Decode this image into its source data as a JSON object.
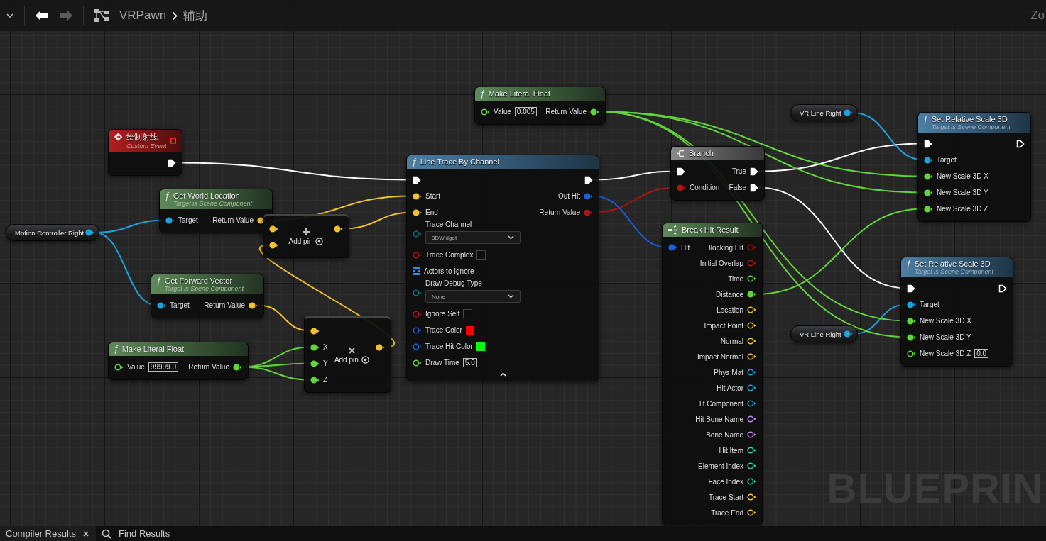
{
  "toolbar": {
    "back_disabled": false,
    "forward_disabled": true,
    "breadcrumb": [
      "VRPawn",
      "辅助"
    ],
    "zoom_label": "Zo"
  },
  "graph": {
    "watermark": "BLUEPRIN",
    "nodes": [
      {
        "kind": "event",
        "title": "绘制射线",
        "subtitle": "Custom Event",
        "rows": [
          {
            "right": {
              "kind": "exec",
              "connected": true
            }
          }
        ]
      },
      {
        "kind": "pure",
        "icon": "ƒ",
        "title": "Get World Location",
        "subtitle": "Target is Scene Component",
        "rows": [
          {
            "left": {
              "label": "Target",
              "kind": "object",
              "connected": true
            },
            "right": {
              "label": "Return Value",
              "kind": "vector",
              "connected": true
            }
          }
        ]
      },
      {
        "kind": "variable",
        "title": "Motion Controller Right",
        "rows": [
          {
            "right": {
              "kind": "object",
              "connected": true
            }
          }
        ]
      },
      {
        "kind": "add",
        "add_pin": "Add pin",
        "rows": [
          {
            "left": {
              "kind": "vector",
              "connected": true
            },
            "right": {
              "kind": "vector",
              "connected": true
            }
          },
          {
            "left": {
              "kind": "vector",
              "connected": true
            }
          }
        ]
      },
      {
        "kind": "pure",
        "icon": "ƒ",
        "title": "Get Forward Vector",
        "subtitle": "Target is Scene Component",
        "rows": [
          {
            "left": {
              "label": "Target",
              "kind": "object",
              "connected": true
            },
            "right": {
              "label": "Return Value",
              "kind": "vector",
              "connected": true
            }
          }
        ]
      },
      {
        "kind": "pure",
        "icon": "ƒ",
        "title": "Make Literal Float",
        "rows": [
          {
            "left": {
              "label": "Value",
              "kind": "float",
              "connected": false,
              "widget": {
                "kind": "text",
                "value": "99999.0"
              }
            },
            "right": {
              "label": "Return Value",
              "kind": "float",
              "connected": true
            }
          }
        ]
      },
      {
        "kind": "multiply",
        "add_pin": "Add pin",
        "rows": [
          {
            "left": {
              "kind": "vector",
              "connected": true
            }
          },
          {
            "left": {
              "label": "X",
              "kind": "float",
              "connected": true
            },
            "right": {
              "kind": "vector",
              "connected": true
            }
          },
          {
            "left": {
              "label": "Y",
              "kind": "float",
              "connected": true
            }
          },
          {
            "left": {
              "label": "Z",
              "kind": "float",
              "connected": true
            }
          }
        ]
      },
      {
        "kind": "pure",
        "icon": "ƒ",
        "title": "Make Literal Float",
        "rows": [
          {
            "left": {
              "label": "Value",
              "kind": "float",
              "connected": false,
              "widget": {
                "kind": "text",
                "value": "0.005"
              }
            },
            "right": {
              "label": "Return Value",
              "kind": "float",
              "connected": true
            }
          }
        ]
      },
      {
        "kind": "function",
        "icon": "ƒ",
        "title": "Line Trace By Channel",
        "advanced_expanded": true,
        "rows": [
          {
            "left": {
              "kind": "exec",
              "connected": true
            },
            "right": {
              "kind": "exec",
              "connected": true
            }
          },
          {
            "left": {
              "label": "Start",
              "kind": "vector",
              "connected": true
            },
            "right": {
              "label": "Out Hit",
              "kind": "struct",
              "connected": true
            }
          },
          {
            "left": {
              "label": "End",
              "kind": "vector",
              "connected": true
            },
            "right": {
              "label": "Return Value",
              "kind": "bool",
              "connected": true
            }
          },
          {
            "left": {
              "label": "Trace Channel",
              "kind": "enum",
              "connected": false,
              "widget": {
                "kind": "dropdown",
                "value": "3DWidget"
              }
            }
          },
          {
            "left": {
              "label": "Trace Complex",
              "kind": "bool",
              "connected": false,
              "widget": {
                "kind": "checkbox",
                "checked": false
              }
            }
          },
          {
            "left": {
              "label": "Actors to Ignore",
              "kind": "array",
              "connected": false
            }
          },
          {
            "left": {
              "label": "Draw Debug Type",
              "kind": "enum",
              "connected": false,
              "widget": {
                "kind": "dropdown",
                "value": "None"
              }
            }
          },
          {
            "left": {
              "label": "Ignore Self",
              "kind": "bool",
              "connected": false,
              "widget": {
                "kind": "checkbox",
                "checked": false
              }
            }
          },
          {
            "left": {
              "label": "Trace Color",
              "kind": "struct",
              "connected": false,
              "widget": {
                "kind": "swatch",
                "color": "#ff0000"
              }
            }
          },
          {
            "left": {
              "label": "Trace Hit Color",
              "kind": "struct",
              "connected": false,
              "widget": {
                "kind": "swatch",
                "color": "#00ff00"
              }
            }
          },
          {
            "left": {
              "label": "Draw Time",
              "kind": "float",
              "connected": false,
              "widget": {
                "kind": "text",
                "value": "5.0"
              }
            }
          }
        ]
      },
      {
        "kind": "branch",
        "title": "Branch",
        "rows": [
          {
            "left": {
              "kind": "exec",
              "connected": true
            },
            "right": {
              "label": "True",
              "kind": "exec",
              "connected": true
            }
          },
          {
            "left": {
              "label": "Condition",
              "kind": "bool",
              "connected": true
            },
            "right": {
              "label": "False",
              "kind": "exec",
              "connected": true
            }
          }
        ]
      },
      {
        "kind": "break",
        "title": "Break Hit Result",
        "rows": [
          {
            "left": {
              "label": "Hit",
              "kind": "struct",
              "connected": true
            },
            "right": {
              "label": "Blocking Hit",
              "kind": "bool",
              "connected": false
            }
          },
          {
            "right": {
              "label": "Initial Overlap",
              "kind": "bool",
              "connected": false
            }
          },
          {
            "right": {
              "label": "Time",
              "kind": "float",
              "connected": false
            }
          },
          {
            "right": {
              "label": "Distance",
              "kind": "float",
              "connected": true
            }
          },
          {
            "right": {
              "label": "Location",
              "kind": "vector",
              "connected": false
            }
          },
          {
            "right": {
              "label": "Impact Point",
              "kind": "vector",
              "connected": false
            }
          },
          {
            "right": {
              "label": "Normal",
              "kind": "vector",
              "connected": false
            }
          },
          {
            "right": {
              "label": "Impact Normal",
              "kind": "vector",
              "connected": false
            }
          },
          {
            "right": {
              "label": "Phys Mat",
              "kind": "object",
              "connected": false
            }
          },
          {
            "right": {
              "label": "Hit Actor",
              "kind": "object",
              "connected": false
            }
          },
          {
            "right": {
              "label": "Hit Component",
              "kind": "object",
              "connected": false
            }
          },
          {
            "right": {
              "label": "Hit Bone Name",
              "kind": "name",
              "connected": false
            }
          },
          {
            "right": {
              "label": "Bone Name",
              "kind": "name",
              "connected": false
            }
          },
          {
            "right": {
              "label": "Hit Item",
              "kind": "int",
              "connected": false
            }
          },
          {
            "right": {
              "label": "Element Index",
              "kind": "int",
              "connected": false
            }
          },
          {
            "right": {
              "label": "Face Index",
              "kind": "int",
              "connected": false
            }
          },
          {
            "right": {
              "label": "Trace Start",
              "kind": "vector",
              "connected": false
            }
          },
          {
            "right": {
              "label": "Trace End",
              "kind": "vector",
              "connected": false
            }
          }
        ]
      },
      {
        "kind": "variable",
        "title": "VR Line Right",
        "rows": [
          {
            "right": {
              "kind": "object",
              "connected": true
            }
          }
        ]
      },
      {
        "kind": "function",
        "icon": "ƒ",
        "title": "Set Relative Scale 3D",
        "subtitle": "Target is Scene Component",
        "rows": [
          {
            "left": {
              "kind": "exec",
              "connected": true
            },
            "right": {
              "kind": "exec",
              "connected": false
            }
          },
          {
            "left": {
              "label": "Target",
              "kind": "object",
              "connected": true
            }
          },
          {
            "left": {
              "label": "New Scale 3D X",
              "kind": "float",
              "connected": true
            }
          },
          {
            "left": {
              "label": "New Scale 3D Y",
              "kind": "float",
              "connected": true
            }
          },
          {
            "left": {
              "label": "New Scale 3D Z",
              "kind": "float",
              "connected": true
            }
          }
        ]
      },
      {
        "kind": "variable",
        "title": "VR Line Right",
        "rows": [
          {
            "right": {
              "kind": "object",
              "connected": true
            }
          }
        ]
      },
      {
        "kind": "function",
        "icon": "ƒ",
        "title": "Set Relative Scale 3D",
        "subtitle": "Target is Scene Component",
        "rows": [
          {
            "left": {
              "kind": "exec",
              "connected": true
            },
            "right": {
              "kind": "exec",
              "connected": false
            }
          },
          {
            "left": {
              "label": "Target",
              "kind": "object",
              "connected": true
            }
          },
          {
            "left": {
              "label": "New Scale 3D X",
              "kind": "float",
              "connected": true
            }
          },
          {
            "left": {
              "label": "New Scale 3D Y",
              "kind": "float",
              "connected": true
            }
          },
          {
            "left": {
              "label": "New Scale 3D Z",
              "kind": "float",
              "connected": false,
              "widget": {
                "kind": "text",
                "value": "0.0"
              }
            }
          }
        ]
      }
    ]
  },
  "bottom_tabs": [
    {
      "kind": "closable",
      "label": "Compiler Results",
      "selected": true
    },
    {
      "kind": "search",
      "label": "Find Results",
      "selected": false
    }
  ]
}
